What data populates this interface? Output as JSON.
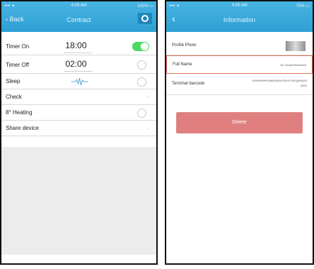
{
  "left_screen": {
    "status": {
      "carrier": "•••• ✦",
      "time": "4:09 AM",
      "battery": "100% ▭"
    },
    "nav": {
      "back_label": "‹ Back",
      "title": "Contract"
    },
    "rows": [
      {
        "label": "Timer On",
        "time": "18:00"
      },
      {
        "label": "Timer Off",
        "time": "02:00"
      },
      {
        "label": "Sleep"
      },
      {
        "label": "Check"
      },
      {
        "label": "8° Heating"
      },
      {
        "label": "Share device"
      }
    ],
    "timer_on_enabled": true
  },
  "right_screen": {
    "status": {
      "carrier": "•••• ✦",
      "time": "4:09 AM",
      "battery": "70% ▭"
    },
    "nav": {
      "title": "Information"
    },
    "rows": [
      {
        "label": "Profile Photo"
      },
      {
        "label": "Full Name",
        "value": "AC Grand/Tetemri04"
      },
      {
        "label": "Terminal barcode",
        "value": "rDRHRWPHVM0000047RUSTUEQAHAG9\n0002"
      }
    ],
    "delete_label": "Delete"
  },
  "colors": {
    "nav_bar": "#3aa9dc",
    "toggle_on": "#4cd964",
    "delete_button": "#e07f7f",
    "highlight_border": "#e8705e"
  }
}
